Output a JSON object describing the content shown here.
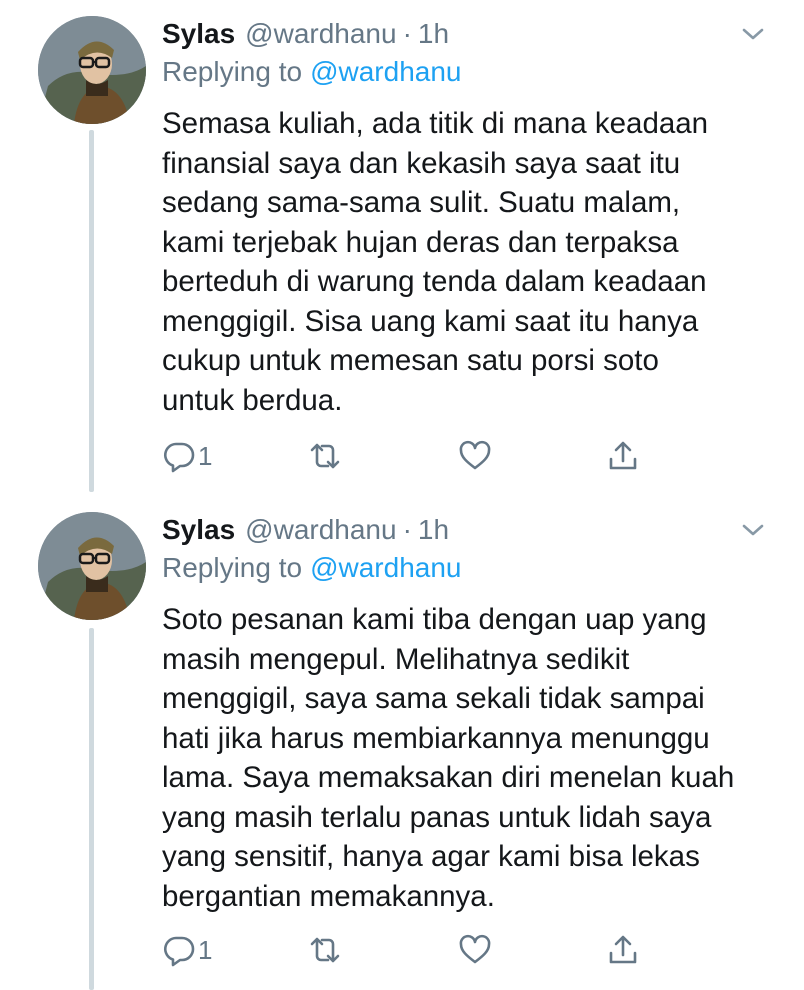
{
  "tweets": [
    {
      "author_name": "Sylas",
      "handle": "@wardhanu",
      "separator": "·",
      "time": "1h",
      "replying_prefix": "Replying to",
      "replying_to": "@wardhanu",
      "body_lines": [
        "Semasa kuliah, ada titik di mana keadaan",
        "finansial saya dan kekasih saya saat itu",
        "sedang sama-sama sulit. Suatu malam,",
        "kami terjebak hujan deras dan terpaksa",
        "berteduh di warung tenda dalam keadaan",
        "menggigil. Sisa uang kami saat itu hanya",
        "cukup untuk memesan satu porsi soto",
        "untuk berdua."
      ],
      "reply_count": "1",
      "icons": [
        "reply-icon",
        "retweet-icon",
        "like-icon",
        "share-icon",
        "chevron-down-icon"
      ]
    },
    {
      "author_name": "Sylas",
      "handle": "@wardhanu",
      "separator": "·",
      "time": "1h",
      "replying_prefix": "Replying to",
      "replying_to": "@wardhanu",
      "body_lines": [
        "Soto pesanan kami tiba dengan uap yang",
        "masih mengepul. Melihatnya sedikit",
        "menggigil, saya sama sekali tidak sampai",
        "hati jika harus membiarkannya menunggu",
        "lama. Saya memaksakan diri menelan kuah",
        "yang masih terlalu panas untuk lidah saya",
        "yang sensitif, hanya agar kami bisa lekas",
        "bergantian memakannya."
      ],
      "reply_count": "1",
      "icons": [
        "reply-icon",
        "retweet-icon",
        "like-icon",
        "share-icon",
        "chevron-down-icon"
      ]
    }
  ],
  "colors": {
    "text": "#14171a",
    "secondary": "#657786",
    "link": "#1da1f2",
    "thread_line": "#cfd9de"
  }
}
